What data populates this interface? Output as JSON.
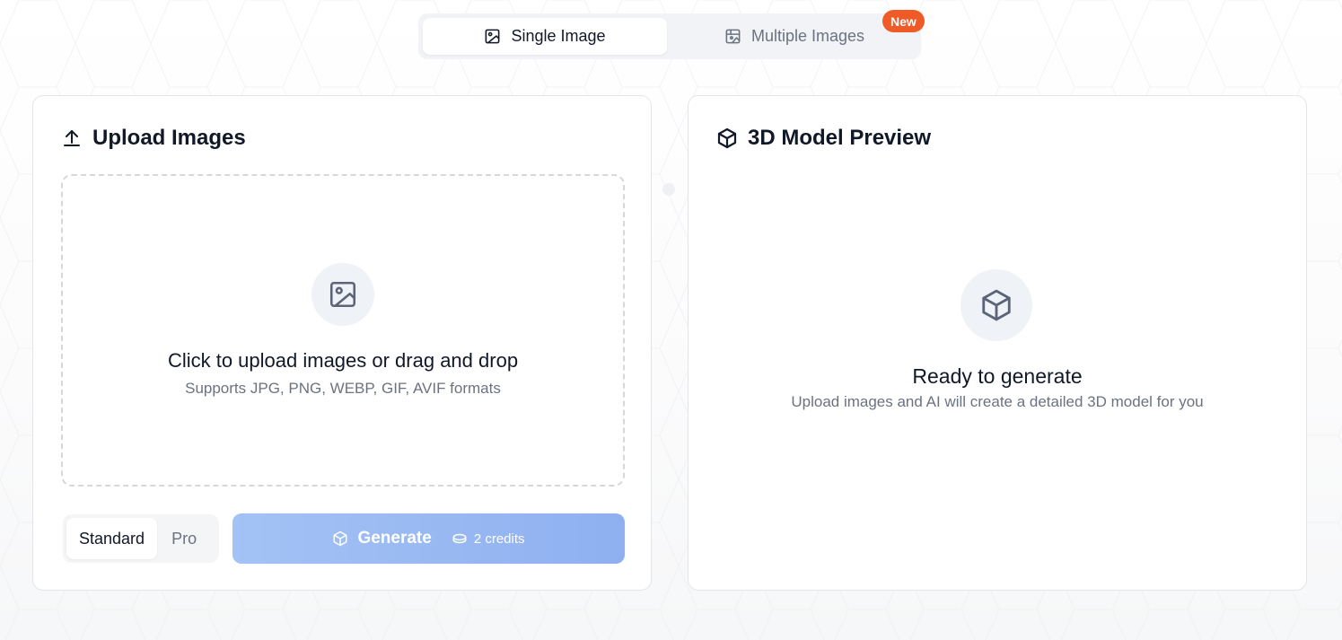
{
  "mode_toggle": {
    "tabs": [
      {
        "label": "Single Image",
        "icon": "image-icon",
        "active": true
      },
      {
        "label": "Multiple Images",
        "icon": "multi-image-icon",
        "active": false
      }
    ],
    "badge": "New"
  },
  "upload_panel": {
    "title": "Upload Images",
    "title_icon": "upload-icon",
    "dropzone": {
      "icon": "image-icon",
      "title": "Click to upload images or drag and drop",
      "subtitle": "Supports JPG, PNG, WEBP, GIF, AVIF formats"
    },
    "quality": {
      "options": [
        "Standard",
        "Pro"
      ],
      "selected": "Standard"
    },
    "generate": {
      "label": "Generate",
      "icon": "cube-icon",
      "credits": "2 credits",
      "credits_icon": "coin-icon",
      "enabled": false
    }
  },
  "preview_panel": {
    "title": "3D Model Preview",
    "title_icon": "cube-icon",
    "empty_state": {
      "icon": "cube-icon",
      "title": "Ready to generate",
      "subtitle": "Upload images and AI will create a detailed 3D model for you"
    }
  },
  "colors": {
    "badge": "#f05a26",
    "generate_button_disabled": "#9bbaf3",
    "muted_text": "#6b7280"
  }
}
